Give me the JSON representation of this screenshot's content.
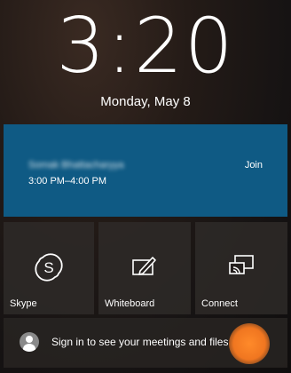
{
  "clock": {
    "time": "3:20",
    "date": "Monday, May 8"
  },
  "meeting": {
    "organizer": "Somak Bhattacharyya",
    "time_range": "3:00 PM–4:00 PM",
    "join_label": "Join"
  },
  "tiles": [
    {
      "label": "Skype",
      "icon": "skype-icon"
    },
    {
      "label": "Whiteboard",
      "icon": "whiteboard-pen-icon"
    },
    {
      "label": "Connect",
      "icon": "cast-screen-icon"
    }
  ],
  "signin": {
    "text": "Sign in to see your meetings and files",
    "icon": "user-avatar-icon"
  },
  "colors": {
    "meeting_tile": "#0f5a84",
    "touch_indicator": "#f07620"
  }
}
